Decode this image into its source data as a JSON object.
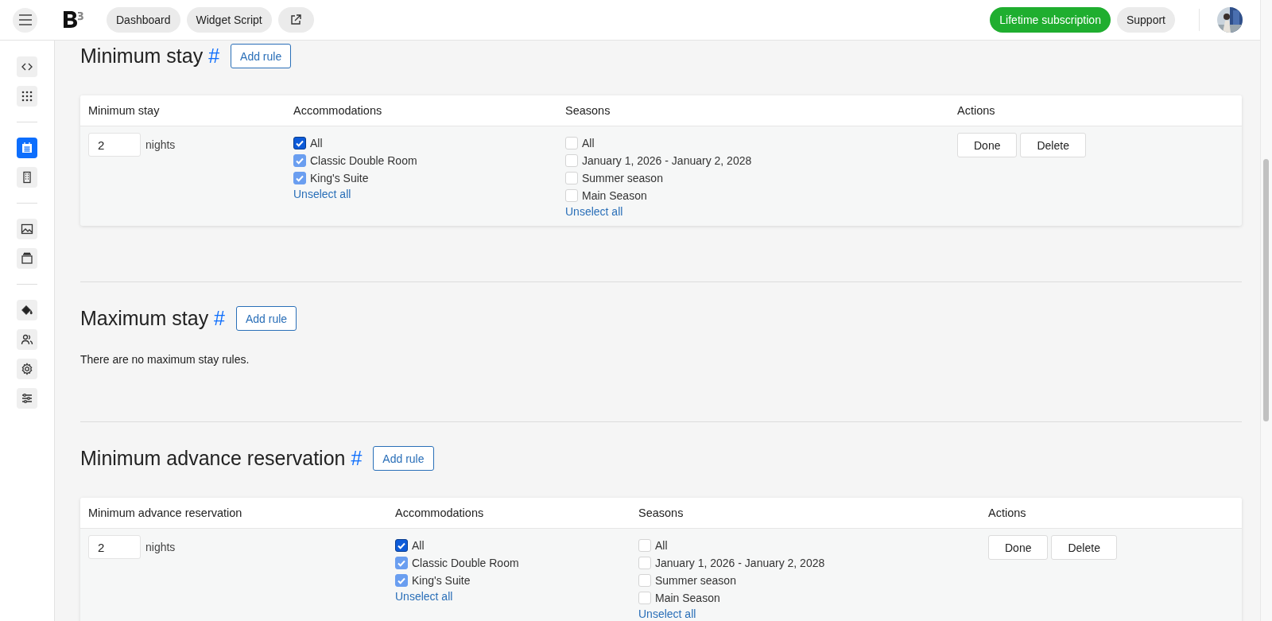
{
  "topbar": {
    "nav_buttons": [
      "Dashboard",
      "Widget Script"
    ],
    "subscription_button": "Lifetime subscription",
    "support_button": "Support"
  },
  "sidebar": {
    "groups": [
      {
        "items": [
          {
            "selected": false
          },
          {
            "selected": false
          }
        ]
      },
      {
        "items": [
          {
            "selected": true
          },
          {
            "selected": false
          }
        ]
      },
      {
        "items": [
          {
            "selected": false
          },
          {
            "selected": false
          }
        ]
      },
      {
        "items": [
          {
            "selected": false
          },
          {
            "selected": false
          },
          {
            "selected": false
          },
          {
            "selected": false
          }
        ]
      }
    ]
  },
  "sections": [
    {
      "kind": "table",
      "title": "Minimum stay",
      "anchor": "#",
      "add_button": "Add rule",
      "table": {
        "columns": [
          "Minimum stay",
          "Accommodations",
          "Seasons",
          "Actions"
        ],
        "rows": [
          {
            "value": "2",
            "unit": "nights",
            "accommodations": [
              {
                "label": "All",
                "checked": true,
                "disabled": false
              },
              {
                "label": "Classic Double Room",
                "checked": true,
                "disabled": true
              },
              {
                "label": "King's Suite",
                "checked": true,
                "disabled": true
              }
            ],
            "accommodations_link": "Unselect all",
            "seasons": [
              {
                "label": "All",
                "checked": false,
                "disabled": false
              },
              {
                "label": "January 1, 2026 - January 2, 2028",
                "checked": false,
                "disabled": false
              },
              {
                "label": "Summer season",
                "checked": false,
                "disabled": false
              },
              {
                "label": "Main Season",
                "checked": false,
                "disabled": false
              }
            ],
            "seasons_link": "Unselect all",
            "actions": [
              "Done",
              "Delete"
            ]
          }
        ]
      }
    },
    {
      "kind": "empty",
      "title": "Maximum stay",
      "anchor": "#",
      "add_button": "Add rule",
      "message": "There are no maximum stay rules."
    },
    {
      "kind": "table",
      "title": "Minimum advance reservation",
      "anchor": "#",
      "add_button": "Add rule",
      "table": {
        "columns": [
          "Minimum advance reservation",
          "Accommodations",
          "Seasons",
          "Actions"
        ],
        "rows": [
          {
            "value": "2",
            "unit": "nights",
            "accommodations": [
              {
                "label": "All",
                "checked": true,
                "disabled": false
              },
              {
                "label": "Classic Double Room",
                "checked": true,
                "disabled": true
              },
              {
                "label": "King's Suite",
                "checked": true,
                "disabled": true
              }
            ],
            "accommodations_link": "Unselect all",
            "seasons": [
              {
                "label": "All",
                "checked": false,
                "disabled": false
              },
              {
                "label": "January 1, 2026 - January 2, 2028",
                "checked": false,
                "disabled": false
              },
              {
                "label": "Summer season",
                "checked": false,
                "disabled": false
              },
              {
                "label": "Main Season",
                "checked": false,
                "disabled": false
              }
            ],
            "seasons_link": "Unselect all",
            "actions": [
              "Done",
              "Delete"
            ]
          }
        ]
      }
    }
  ]
}
